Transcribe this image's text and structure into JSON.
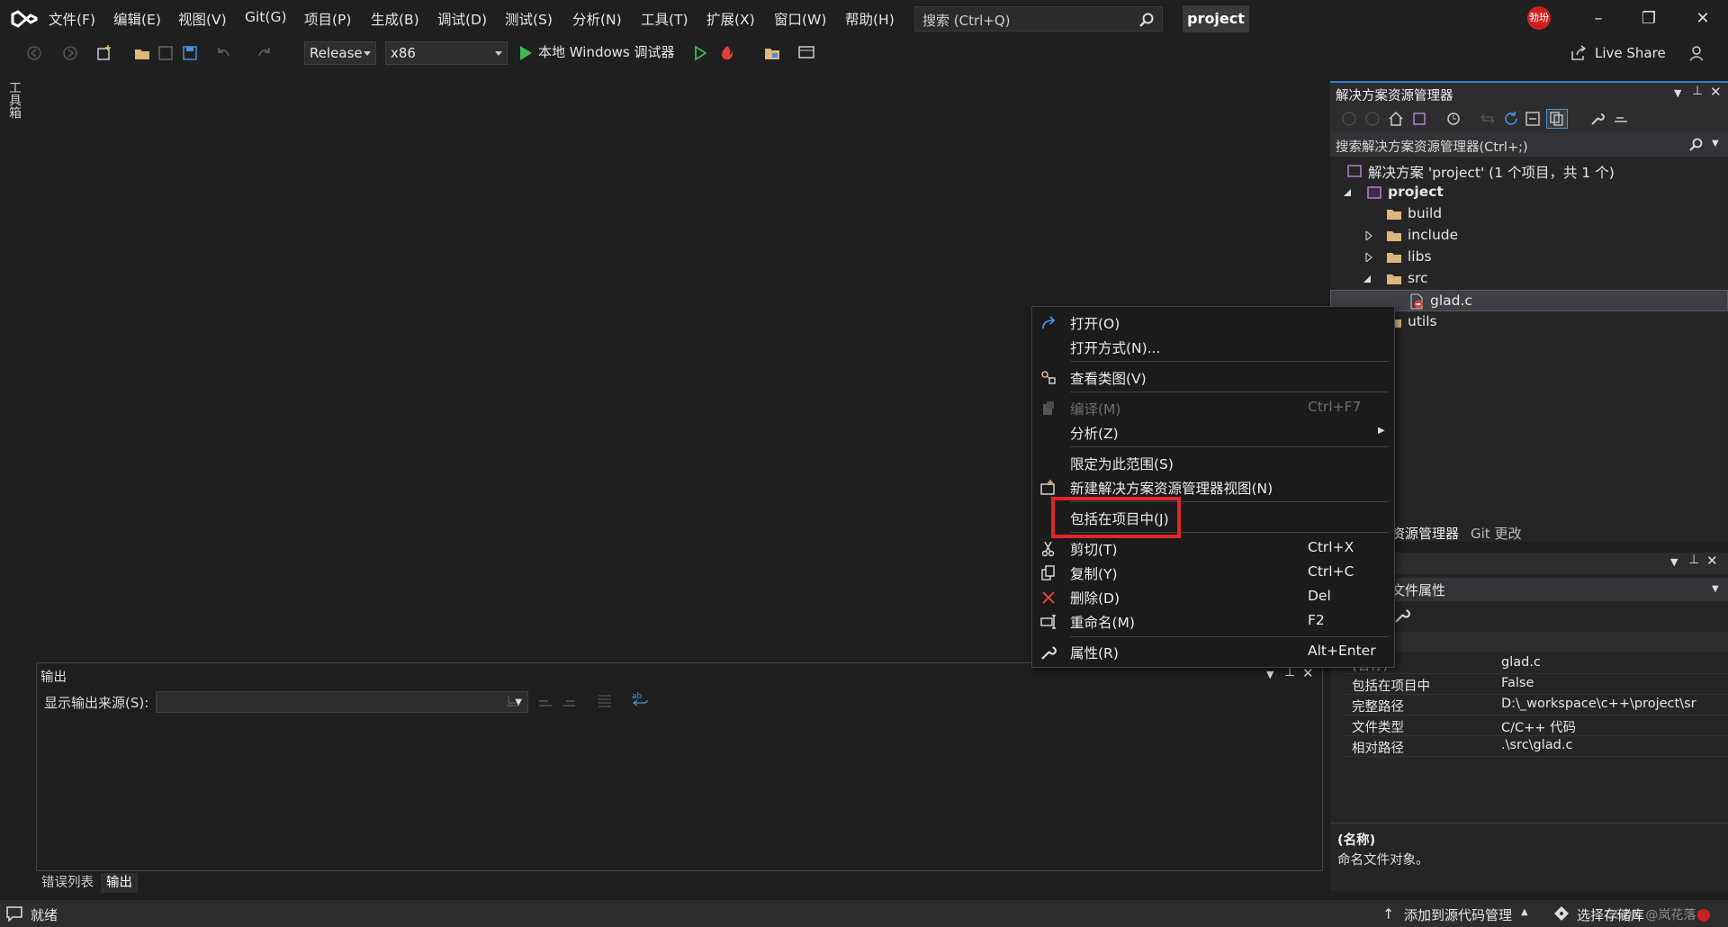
{
  "menu": [
    "文件(F)",
    "编辑(E)",
    "视图(V)",
    "Git(G)",
    "项目(P)",
    "生成(B)",
    "调试(D)",
    "测试(S)",
    "分析(N)",
    "工具(T)",
    "扩展(X)",
    "窗口(W)",
    "帮助(H)"
  ],
  "search": {
    "placeholder": "搜索 (Ctrl+Q)"
  },
  "project_name": "project",
  "avatar_text": "勃玢",
  "toolbar": {
    "config": "Release",
    "platform": "x86",
    "debugger": "本地 Windows 调试器",
    "liveshare": "Live Share"
  },
  "toolbox_label": "工具箱",
  "solution_explorer": {
    "title": "解决方案资源管理器",
    "search_placeholder": "搜索解决方案资源管理器(Ctrl+;)",
    "tree": {
      "solution": "解决方案 'project' (1 个项目，共 1 个)",
      "project": "project",
      "build": "build",
      "include": "include",
      "libs": "libs",
      "src": "src",
      "glad": "glad.c",
      "utils": "utils"
    },
    "tabs": [
      "解决方案资源管理器",
      "Git 更改"
    ],
    "tab_visible_text": "资源管理器"
  },
  "properties": {
    "title_fragment": "文件属性",
    "rows": [
      {
        "key": "(名称)",
        "value": "glad.c"
      },
      {
        "key": "包括在项目中",
        "value": "False"
      },
      {
        "key": "完整路径",
        "value": "D:\\_workspace\\c++\\project\\sr"
      },
      {
        "key": "文件类型",
        "value": "C/C++ 代码"
      },
      {
        "key": "相对路径",
        "value": ".\\src\\glad.c"
      }
    ],
    "desc_title": "(名称)",
    "desc_text": "命名文件对象。"
  },
  "output": {
    "title": "输出",
    "source_label": "显示输出来源(S):",
    "tabs": [
      "错误列表",
      "输出"
    ]
  },
  "context_menu": {
    "open": "打开(O)",
    "open_with": "打开方式(N)...",
    "view_class": "查看类图(V)",
    "compile": "编译(M)",
    "compile_shortcut": "Ctrl+F7",
    "analyze": "分析(Z)",
    "scope": "限定为此范围(S)",
    "new_view": "新建解决方案资源管理器视图(N)",
    "include": "包括在项目中(J)",
    "cut": "剪切(T)",
    "cut_shortcut": "Ctrl+X",
    "copy": "复制(Y)",
    "copy_shortcut": "Ctrl+C",
    "delete": "删除(D)",
    "delete_shortcut": "Del",
    "rename": "重命名(M)",
    "rename_shortcut": "F2",
    "properties": "属性(R)",
    "properties_shortcut": "Alt+Enter"
  },
  "status": {
    "ready": "就绪",
    "add_source": "添加到源代码管理",
    "select_repo": "选择存储库"
  },
  "watermark": "CSDN @岚花落",
  "colors": {
    "accent": "#2d7ed8",
    "highlight_box": "#e2242a",
    "play_green": "#3fb950",
    "folder": "#dcb67a"
  }
}
